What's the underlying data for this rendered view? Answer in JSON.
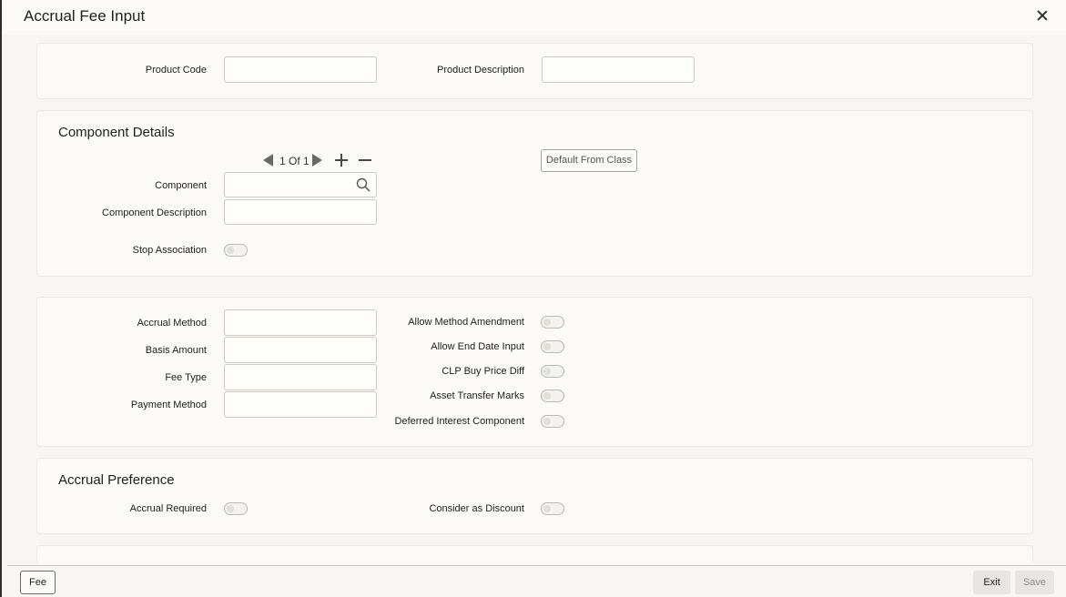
{
  "window": {
    "title": "Accrual Fee Input"
  },
  "product": {
    "code_label": "Product Code",
    "code_value": "",
    "description_label": "Product Description",
    "description_value": ""
  },
  "component_details": {
    "title": "Component Details",
    "pagination": {
      "text": "1 Of 1"
    },
    "default_from_class_label": "Default From Class",
    "component_label": "Component",
    "component_value": "",
    "component_description_label": "Component Description",
    "component_description_value": "",
    "stop_association_label": "Stop Association"
  },
  "method": {
    "accrual_method_label": "Accrual Method",
    "basis_amount_label": "Basis Amount",
    "fee_type_label": "Fee Type",
    "payment_method_label": "Payment Method",
    "allow_method_amendment_label": "Allow Method Amendment",
    "allow_end_date_input_label": "Allow End Date Input",
    "clp_buy_price_diff_label": "CLP Buy Price Diff",
    "asset_transfer_marks_label": "Asset Transfer Marks",
    "deferred_interest_component_label": "Deferred Interest Component"
  },
  "accrual_preference": {
    "title": "Accrual Preference",
    "accrual_required_label": "Accrual Required",
    "consider_as_discount_label": "Consider as Discount"
  },
  "footer": {
    "fee_button": "Fee",
    "exit_button": "Exit",
    "save_button": "Save"
  }
}
